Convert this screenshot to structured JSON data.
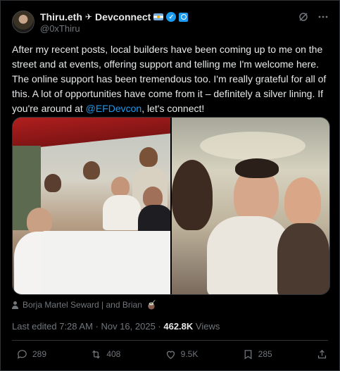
{
  "author": {
    "display_name": "Thiru.eth",
    "name_suffix": "Devconnect",
    "handle": "@0xThiru"
  },
  "post": {
    "text_part1": "After my recent posts, local builders have been coming up to me on the street and at events, offering support and telling me I'm welcome here. The online support has been tremendous too. I'm really grateful for all of this. A lot of opportunities have come from it – definitely a silver lining. If you're around at ",
    "mention": "@EFDevcon",
    "text_part2": ", let's connect!"
  },
  "tagged": "Borja Martel Seward | and Brian",
  "meta": {
    "edited": "Last edited 7:28 AM · Nov 16, 2025 · ",
    "views_count": "462.8K",
    "views_label": " Views"
  },
  "actions": {
    "replies": "289",
    "reposts": "408",
    "likes": "9.5K",
    "bookmarks": "285"
  },
  "icons": [
    "airplane-icon",
    "argentina-flag-icon",
    "verified-badge-icon",
    "affiliate-badge-icon",
    "grok-icon",
    "more-icon",
    "person-tag-icon",
    "mate-icon",
    "reply-icon",
    "repost-icon",
    "like-icon",
    "bookmark-icon",
    "share-icon"
  ],
  "colors": {
    "accent": "#1d9bf0",
    "muted": "#71767b",
    "text": "#e7e9ea",
    "background": "#000000"
  }
}
